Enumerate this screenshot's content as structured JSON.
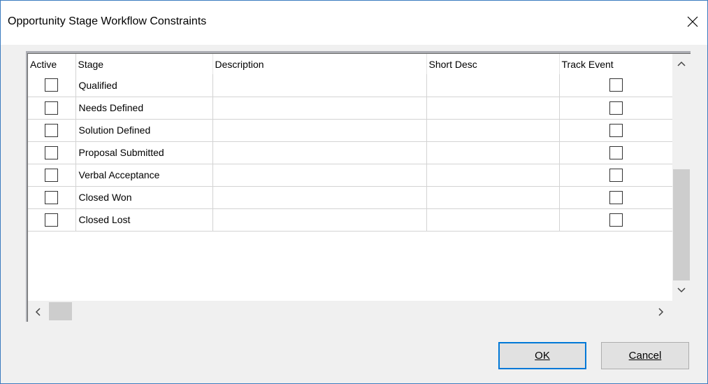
{
  "window": {
    "title": "Opportunity Stage Workflow Constraints",
    "close_icon": "close-icon"
  },
  "grid": {
    "columns": [
      "Active",
      "Stage",
      "Description",
      "Short Desc",
      "Track Event"
    ],
    "rows": [
      {
        "active": false,
        "stage": "Qualified",
        "description": "",
        "short_desc": "",
        "track_event": false
      },
      {
        "active": false,
        "stage": "Needs Defined",
        "description": "",
        "short_desc": "",
        "track_event": false
      },
      {
        "active": false,
        "stage": "Solution Defined",
        "description": "",
        "short_desc": "",
        "track_event": false
      },
      {
        "active": false,
        "stage": "Proposal Submitted",
        "description": "",
        "short_desc": "",
        "track_event": false
      },
      {
        "active": false,
        "stage": "Verbal Acceptance",
        "description": "",
        "short_desc": "",
        "track_event": false
      },
      {
        "active": false,
        "stage": "Closed Won",
        "description": "",
        "short_desc": "",
        "track_event": false
      },
      {
        "active": false,
        "stage": "Closed Lost",
        "description": "",
        "short_desc": "",
        "track_event": false
      }
    ]
  },
  "buttons": {
    "ok_label": "OK",
    "cancel_label": "Cancel"
  }
}
